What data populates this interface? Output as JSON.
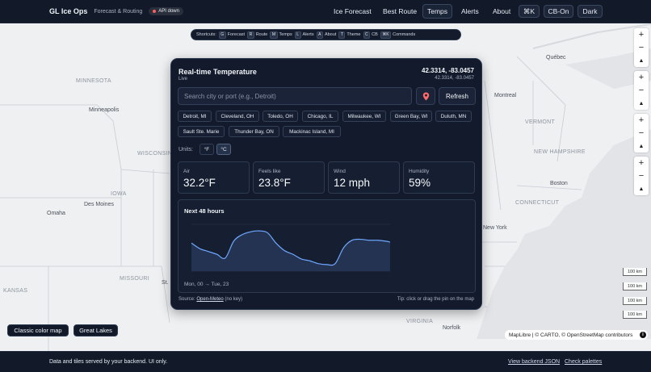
{
  "app": {
    "title": "GL Ice Ops",
    "subtitle": "Forecast & Routing",
    "api_status": "API down",
    "api_status_color": "#ff5d5d"
  },
  "nav": {
    "links": [
      "Ice Forecast",
      "Best Route",
      "Temps",
      "Alerts",
      "About"
    ],
    "active": "Temps",
    "buttons": [
      "⌘K",
      "CB-On",
      "Dark"
    ]
  },
  "shortcuts": {
    "label": "Shortcuts:",
    "items": [
      {
        "key": "G",
        "label": "Forecast"
      },
      {
        "key": "R",
        "label": "Route"
      },
      {
        "key": "M",
        "label": "Temps"
      },
      {
        "key": "L",
        "label": "Alerts"
      },
      {
        "key": "A",
        "label": "About"
      },
      {
        "key": "T",
        "label": "Theme"
      },
      {
        "key": "C",
        "label": "CB"
      },
      {
        "key": "⌘K",
        "label": "Commands"
      }
    ]
  },
  "map": {
    "regions": [
      "MINNESOTA",
      "WISCONSIN",
      "IOWA",
      "MISSOURI",
      "KANSAS",
      "VERMONT",
      "NEW HAMPSHIRE",
      "CONNECTICUT",
      "VIRGINIA"
    ],
    "cities": [
      "Québec",
      "Montreal",
      "Minneapolis",
      "Des Moines",
      "Omaha",
      "Boston",
      "New York",
      "St.",
      "Norfolk"
    ],
    "scale_label": "100 km",
    "attribution": "MapLibre | © CARTO, © OpenStreetMap contributors",
    "style_buttons": [
      "Classic color map",
      "Great Lakes"
    ],
    "controls": {
      "zoom_in": "+",
      "zoom_out": "−",
      "compass": "▲"
    }
  },
  "panel": {
    "title": "Real-time Temperature",
    "status": "Live",
    "coord_main": "42.3314, -83.0457",
    "coord_sub": "42.3314, -83.0457",
    "search_placeholder": "Search city or port (e.g., Detroit)",
    "refresh_label": "Refresh",
    "pin_icon": "map-pin-icon",
    "presets": [
      "Detroit, MI",
      "Cleveland, OH",
      "Toledo, OH",
      "Chicago, IL",
      "Milwaukee, WI",
      "Green Bay, WI",
      "Duluth, MN",
      "Sault Ste. Marie",
      "Thunder Bay, ON",
      "Mackinac Island, MI"
    ],
    "units_label": "Units:",
    "units": [
      "°F",
      "°C"
    ],
    "active_unit": "°C",
    "stats": [
      {
        "label": "Air",
        "value": "32.2°F"
      },
      {
        "label": "Feels like",
        "value": "23.8°F"
      },
      {
        "label": "Wind",
        "value": "12 mph"
      },
      {
        "label": "Humidity",
        "value": "59%"
      }
    ],
    "forecast_title": "Next 48 hours",
    "forecast_range": "Mon, 00 → Tue, 23",
    "source_prefix": "Source:",
    "source_link": "Open-Meteo",
    "source_suffix": "(no key)",
    "tip": "Tip: click or drag the pin on the map"
  },
  "footer": {
    "text": "Data and tiles served by your backend. UI only.",
    "links": [
      "View backend JSON",
      "Check palettes"
    ]
  },
  "colors": {
    "accent": "#6ea8ff",
    "panel_bg": "#121a2b",
    "nav_bg": "#121a2a"
  },
  "chart_data": {
    "type": "area",
    "title": "Next 48 hours",
    "xlabel": "",
    "ylabel": "",
    "x": [
      0,
      2,
      4,
      6,
      8,
      10,
      12,
      14,
      16,
      18,
      20,
      22,
      24,
      26,
      28,
      30,
      32,
      34,
      36,
      38,
      40,
      42,
      44,
      46,
      47
    ],
    "series": [
      {
        "values": [
          30,
          24,
          21,
          18,
          14,
          32,
          39,
          42,
          43,
          41,
          30,
          22,
          18,
          13,
          11,
          8,
          7,
          8,
          25,
          33,
          34,
          33,
          33,
          32,
          31
        ]
      }
    ],
    "ylim": [
      0,
      50
    ]
  }
}
